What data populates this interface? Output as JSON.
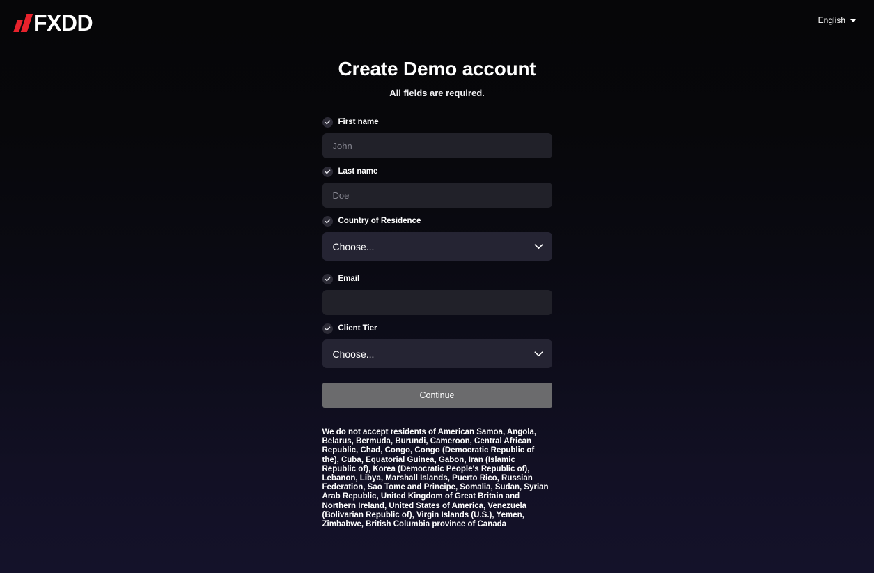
{
  "header": {
    "logo": {
      "text": "FXDD",
      "bar_color": "#e8222c",
      "bars_icon": "fxdd-logo-bars-icon"
    },
    "language": {
      "label": "English",
      "caret_icon": "chevron-down-icon"
    }
  },
  "main": {
    "title": "Create Demo account",
    "subtitle": "All fields are required.",
    "fields": [
      {
        "id": "first-name",
        "label": "First name",
        "type": "text",
        "value": "",
        "placeholder": "John",
        "check_icon": "check-circle-icon"
      },
      {
        "id": "last-name",
        "label": "Last name",
        "type": "text",
        "value": "",
        "placeholder": "Doe",
        "check_icon": "check-circle-icon"
      },
      {
        "id": "country-of-residence",
        "label": "Country of Residence",
        "type": "select",
        "value": "Choose...",
        "placeholder": "Choose...",
        "check_icon": "check-circle-icon",
        "chevron_icon": "chevron-down-icon"
      },
      {
        "id": "email",
        "label": "Email",
        "type": "text",
        "value": "",
        "placeholder": "",
        "check_icon": "check-circle-icon"
      },
      {
        "id": "client-tier",
        "label": "Client Tier",
        "type": "select",
        "value": "Choose...",
        "placeholder": "Choose...",
        "check_icon": "check-circle-icon",
        "chevron_icon": "chevron-down-icon"
      }
    ],
    "continue_button": {
      "label": "Continue",
      "color": "#6b6b6d"
    },
    "disclaimer": "We do not accept residents of American Samoa, Angola, Belarus, Bermuda, Burundi, Cameroon, Central African Republic, Chad, Congo, Congo (Democratic Republic of the), Cuba, Equatorial Guinea, Gabon, Iran (Islamic Republic of), Korea (Democratic People's Republic of), Lebanon, Libya, Marshall Islands, Puerto Rico, Russian Federation, Sao Tome and Principe, Somalia, Sudan, Syrian Arab Republic, United Kingdom of Great Britain and Northern Ireland, United States of America, Venezuela (Bolivarian Republic of), Virgin Islands (U.S.), Yemen, Zimbabwe, British Columbia province of Canada"
  },
  "theme": {
    "background_top": "#060608",
    "background_bottom": "#14122a",
    "input_bg": "#212129",
    "select_bg": "#252433",
    "accent_red": "#e8222c",
    "text": "#ffffff",
    "placeholder": "#85858f"
  }
}
